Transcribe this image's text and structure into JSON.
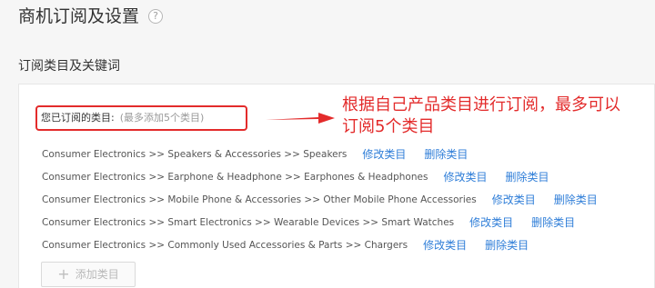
{
  "page": {
    "title": "商机订阅及设置",
    "help_icon": "?"
  },
  "section": {
    "title": "订阅类目及关键词"
  },
  "subscribed": {
    "label": "您已订阅的类目:",
    "limit_hint": "(最多添加5个类目)"
  },
  "annotation": {
    "text": "根据自己产品类目进行订阅，最多可以\n订阅5个类目",
    "color": "#e32b2b"
  },
  "categories": [
    {
      "path": "Consumer Electronics >> Speakers & Accessories >> Speakers",
      "edit_label": "修改类目",
      "delete_label": "删除类目"
    },
    {
      "path": "Consumer Electronics >> Earphone & Headphone >> Earphones & Headphones",
      "edit_label": "修改类目",
      "delete_label": "删除类目"
    },
    {
      "path": "Consumer Electronics >> Mobile Phone & Accessories >> Other Mobile Phone Accessories",
      "edit_label": "修改类目",
      "delete_label": "删除类目"
    },
    {
      "path": "Consumer Electronics >> Smart Electronics >> Wearable Devices >> Smart Watches",
      "edit_label": "修改类目",
      "delete_label": "删除类目"
    },
    {
      "path": "Consumer Electronics >> Commonly Used Accessories & Parts >> Chargers",
      "edit_label": "修改类目",
      "delete_label": "删除类目"
    }
  ],
  "add_button": {
    "icon": "+",
    "label": "添加类目"
  },
  "colors": {
    "link": "#2f7ed8",
    "highlight": "#e32b2b"
  }
}
